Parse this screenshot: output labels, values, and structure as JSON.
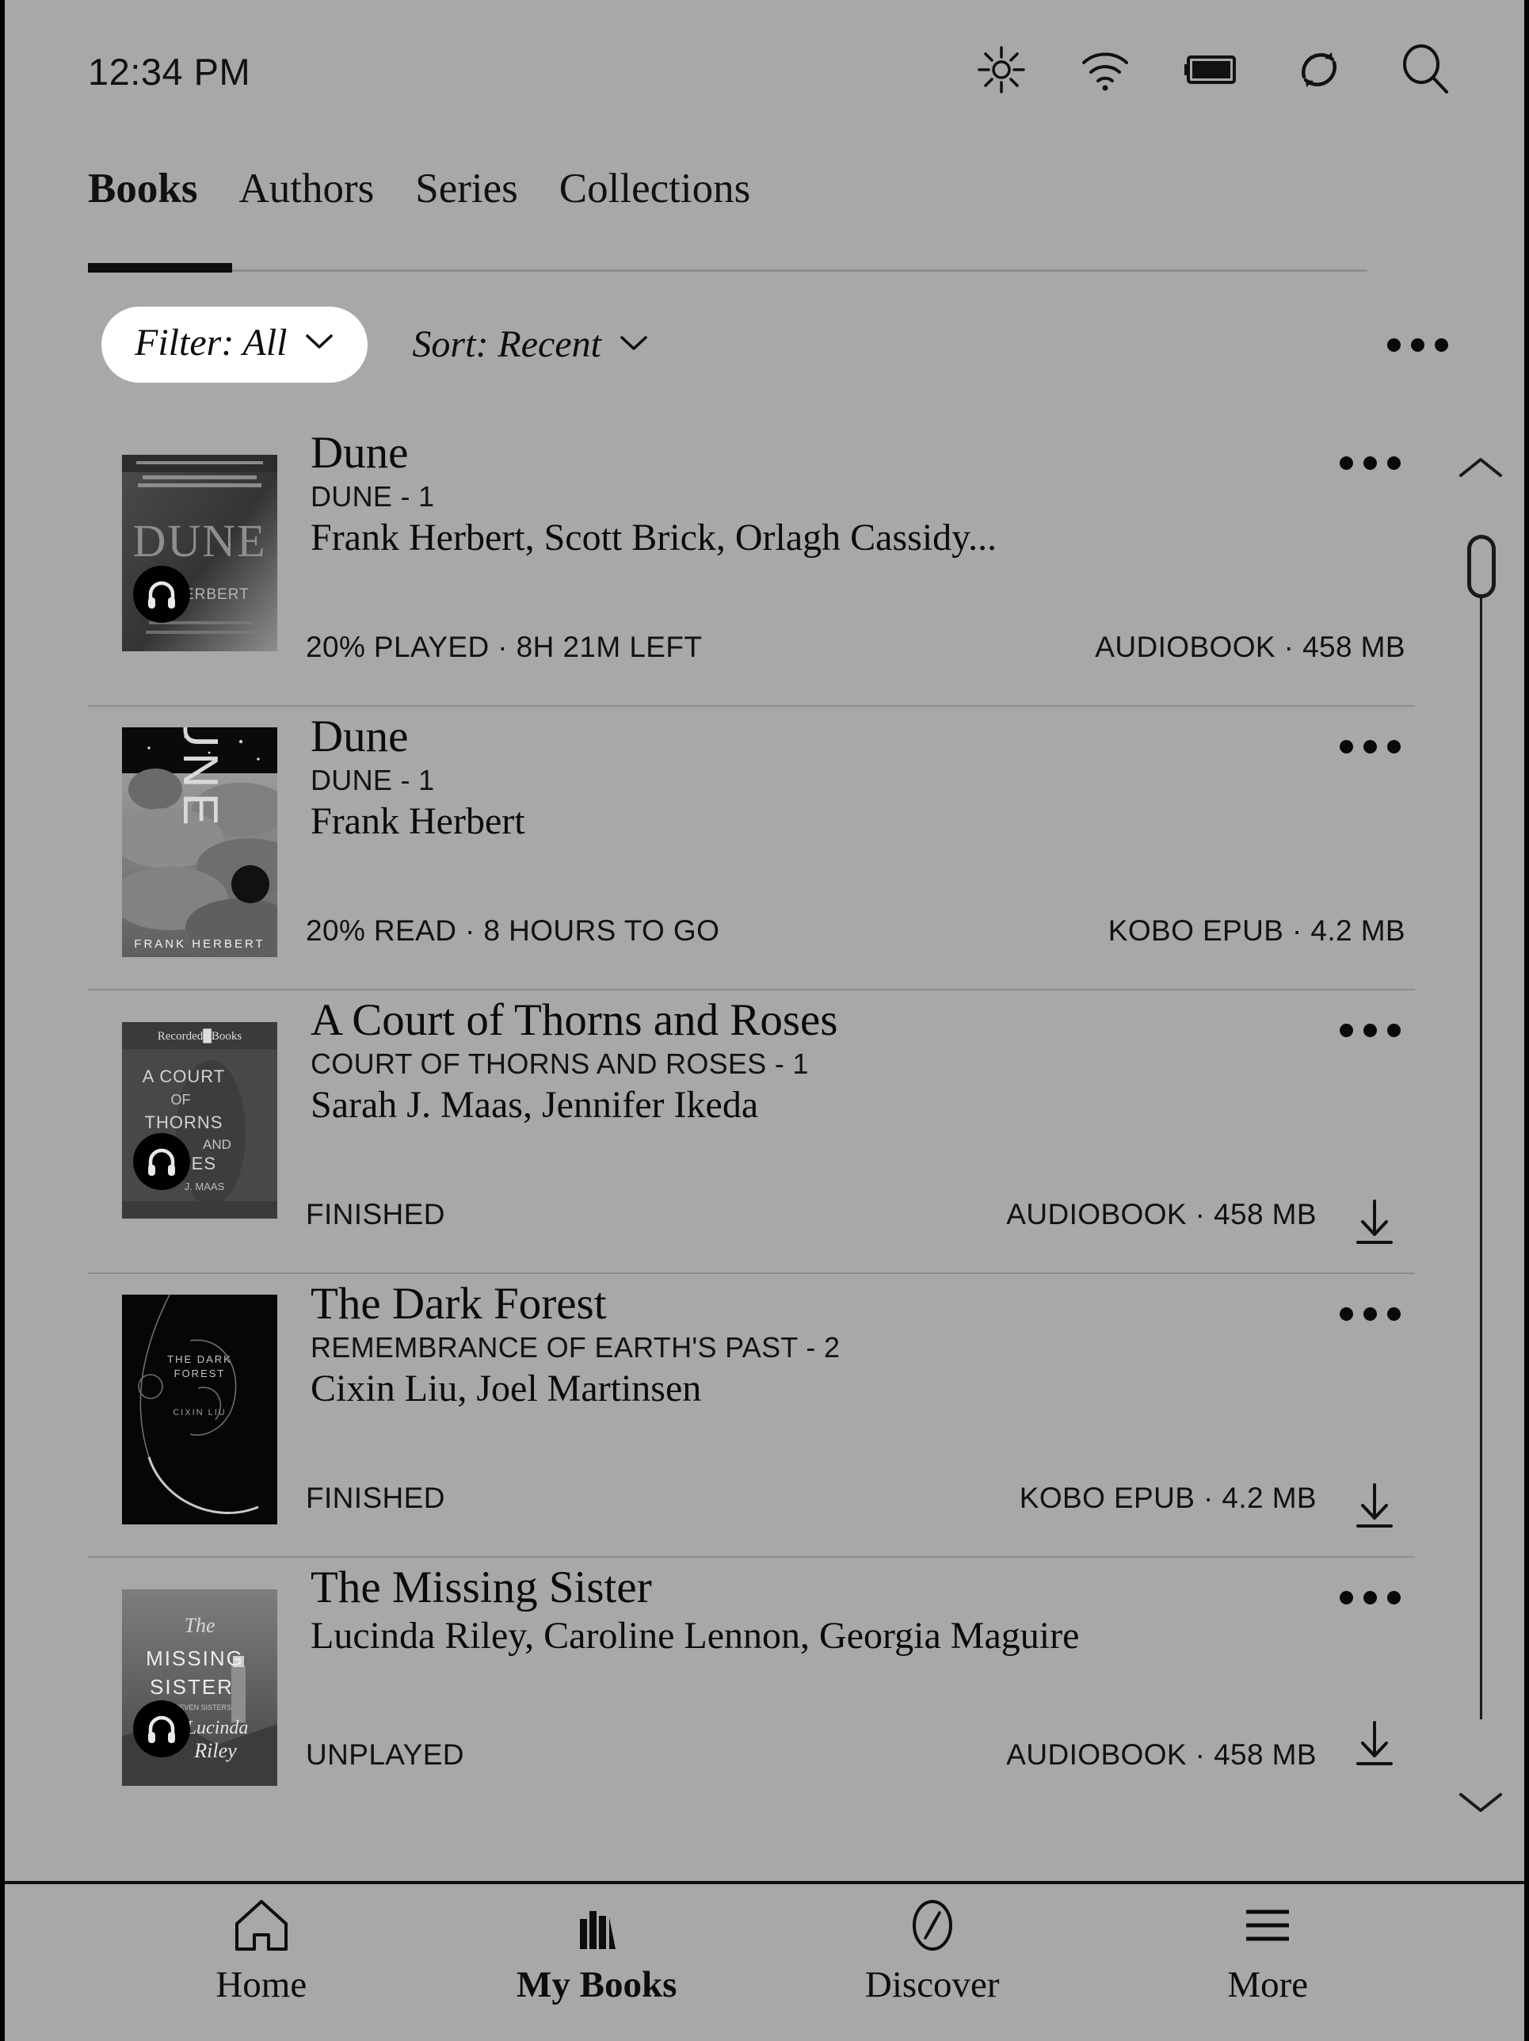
{
  "theme": {
    "background": "#a8a8a8",
    "ink": "#0b0b0b",
    "pill_background": "#ffffff",
    "divider": "#8d8d8d"
  },
  "status_bar": {
    "time": "12:34 PM",
    "icons": [
      "brightness-icon",
      "wifi-icon",
      "battery-icon",
      "sync-icon",
      "search-icon"
    ]
  },
  "tabs": [
    {
      "label": "Books",
      "active": true
    },
    {
      "label": "Authors",
      "active": false
    },
    {
      "label": "Series",
      "active": false
    },
    {
      "label": "Collections",
      "active": false
    }
  ],
  "controls": {
    "filter_label": "Filter: All",
    "sort_label": "Sort: Recent",
    "overflow_label": "•••"
  },
  "books": [
    {
      "title": "Dune",
      "series": "DUNE - 1",
      "author": "Frank Herbert, Scott Brick, Orlagh Cassidy...",
      "status": "20% PLAYED · 8H 21M LEFT",
      "format": "AUDIOBOOK · 458 MB",
      "is_audiobook": true,
      "has_download": false
    },
    {
      "title": "Dune",
      "series": "DUNE - 1",
      "author": "Frank Herbert",
      "status": "20% READ · 8 HOURS TO GO",
      "format": "KOBO EPUB · 4.2 MB",
      "is_audiobook": false,
      "has_download": false
    },
    {
      "title": "A Court of Thorns and Roses",
      "series": "COURT OF THORNS AND ROSES - 1",
      "author": "Sarah J. Maas, Jennifer Ikeda",
      "status": "FINISHED",
      "format": "AUDIOBOOK · 458 MB",
      "is_audiobook": true,
      "has_download": true
    },
    {
      "title": "The Dark Forest",
      "series": "REMEMBRANCE OF EARTH'S PAST - 2",
      "author": "Cixin Liu, Joel Martinsen",
      "status": "FINISHED",
      "format": "KOBO EPUB · 4.2 MB",
      "is_audiobook": false,
      "has_download": true
    },
    {
      "title": "The Missing Sister",
      "series": "",
      "author": "Lucinda Riley, Caroline Lennon, Georgia Maguire",
      "status": "UNPLAYED",
      "format": "AUDIOBOOK · 458 MB",
      "is_audiobook": true,
      "has_download": true
    }
  ],
  "scrollbar": {
    "up_icon": "chevron-up-icon",
    "down_icon": "chevron-down-icon"
  },
  "bottom_nav": [
    {
      "label": "Home",
      "icon": "home-icon",
      "active": false
    },
    {
      "label": "My Books",
      "icon": "books-icon",
      "active": true
    },
    {
      "label": "Discover",
      "icon": "compass-icon",
      "active": false
    },
    {
      "label": "More",
      "icon": "hamburger-icon",
      "active": false
    }
  ]
}
